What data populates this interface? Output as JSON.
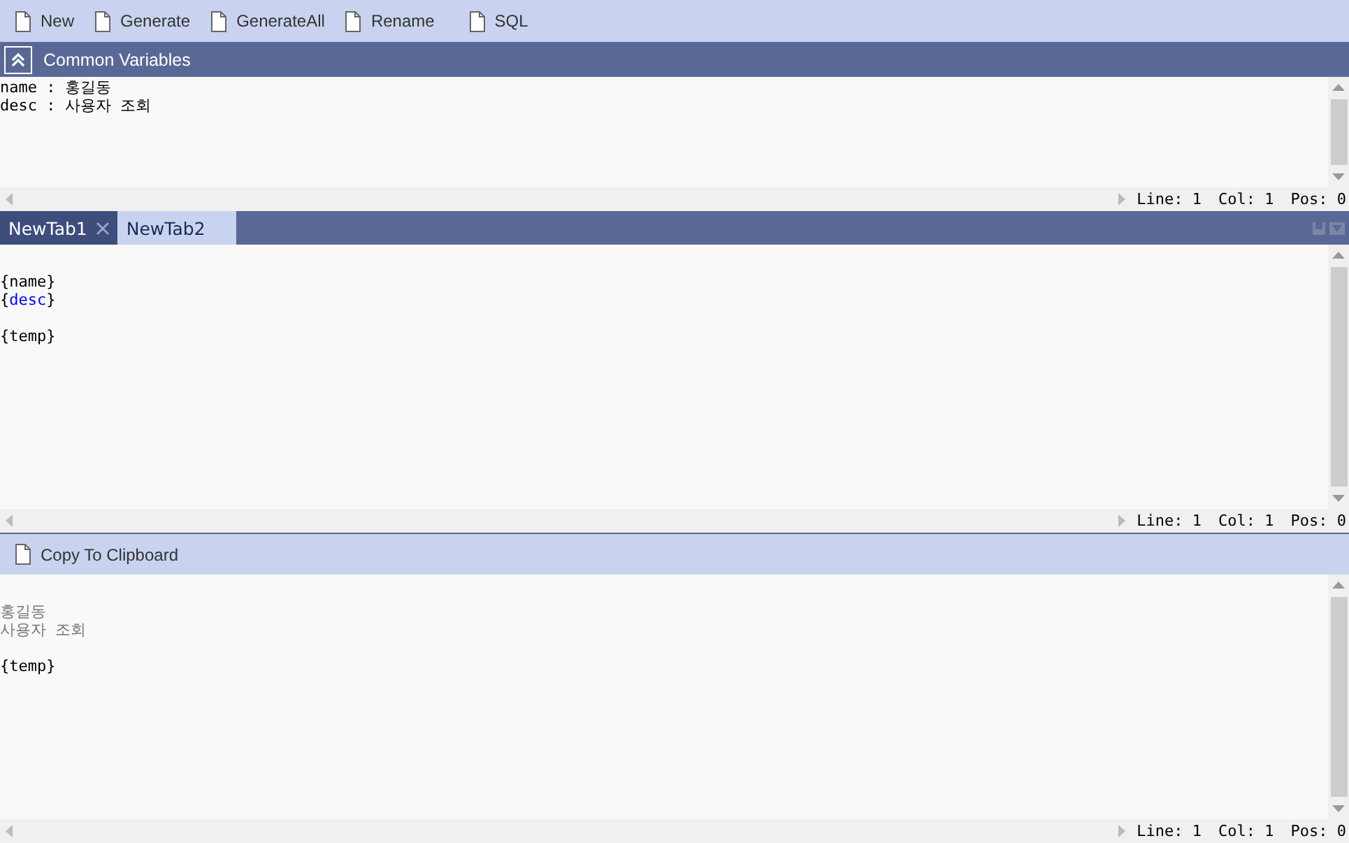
{
  "toolbar": {
    "buttons": [
      {
        "label": "New"
      },
      {
        "label": "Generate"
      },
      {
        "label": "GenerateAll"
      },
      {
        "label": "Rename"
      },
      {
        "label": "SQL"
      }
    ]
  },
  "variables_panel": {
    "title": "Common Variables",
    "expanded": true,
    "editor": {
      "lines": [
        {
          "spans": [
            {
              "text": "name : 홍길동",
              "kind": "plain"
            }
          ]
        },
        {
          "spans": [
            {
              "text": "desc : 사용자 조회",
              "kind": "plain"
            }
          ]
        }
      ],
      "status": {
        "line": "Line: 1",
        "col": "Col: 1",
        "pos": "Pos: 0"
      }
    }
  },
  "tabs": [
    {
      "label": "NewTab1",
      "selected": false,
      "closable": true
    },
    {
      "label": "NewTab2",
      "selected": true,
      "closable": false
    }
  ],
  "template_editor": {
    "lines": [
      {
        "kind": "blank"
      },
      {
        "spans": [
          {
            "text": "{name}",
            "kind": "plain"
          }
        ]
      },
      {
        "spans": [
          {
            "text": "{",
            "kind": "plain"
          },
          {
            "text": "desc",
            "kind": "variable"
          },
          {
            "text": "}",
            "kind": "plain"
          }
        ]
      },
      {
        "kind": "blank"
      },
      {
        "spans": [
          {
            "text": "{temp}",
            "kind": "plain"
          }
        ]
      }
    ],
    "status": {
      "line": "Line: 1",
      "col": "Col: 1",
      "pos": "Pos: 0"
    }
  },
  "output_toolbar": {
    "buttons": [
      {
        "label": "Copy To Clipboard"
      }
    ]
  },
  "output_editor": {
    "lines": [
      {
        "kind": "blank"
      },
      {
        "spans": [
          {
            "text": "홍길동",
            "kind": "output"
          }
        ]
      },
      {
        "spans": [
          {
            "text": "사용자 조회",
            "kind": "output"
          }
        ]
      },
      {
        "kind": "blank"
      },
      {
        "spans": [
          {
            "text": "{temp}",
            "kind": "plain"
          }
        ]
      }
    ],
    "status": {
      "line": "Line: 1",
      "col": "Col: 1",
      "pos": "Pos: 0"
    }
  }
}
